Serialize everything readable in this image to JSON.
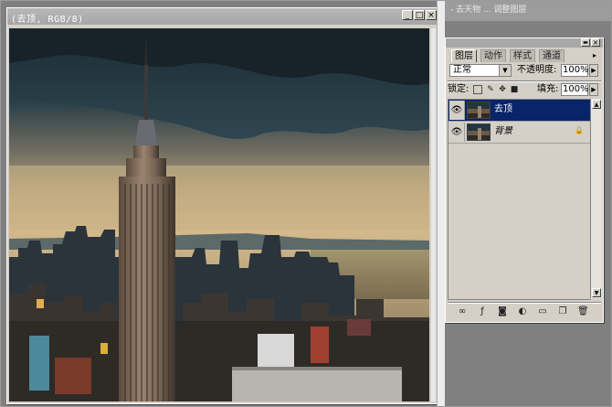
{
  "document": {
    "title": "(去顶, RGB/8)",
    "buttons": {
      "minimize": "_",
      "maximize": "□",
      "close": "×"
    }
  },
  "top_strip": {
    "text": "- 去天物 ... 调整图层"
  },
  "layers_palette": {
    "window_buttons": {
      "minimize": "▬",
      "close": "×"
    },
    "tabs": [
      {
        "label": "图层",
        "active": true
      },
      {
        "label": "动作",
        "active": false
      },
      {
        "label": "样式",
        "active": false
      },
      {
        "label": "通道",
        "active": false
      }
    ],
    "menu_icon": "▸",
    "blend_mode": "正常",
    "opacity_label": "不透明度:",
    "opacity_value": "100%",
    "lock_label": "锁定:",
    "fill_label": "填充:",
    "fill_value": "100%",
    "layers": [
      {
        "name": "去顶",
        "selected": true,
        "visible": true,
        "locked": false
      },
      {
        "name": "背景",
        "selected": false,
        "visible": true,
        "locked": true
      }
    ],
    "bottom_icons": [
      "link-icon",
      "layer-style-icon",
      "mask-icon",
      "adjustment-icon",
      "folder-icon",
      "new-layer-icon",
      "trash-icon"
    ]
  },
  "colors": {
    "selection": "#0a246a",
    "panel": "#d4d0c8"
  }
}
